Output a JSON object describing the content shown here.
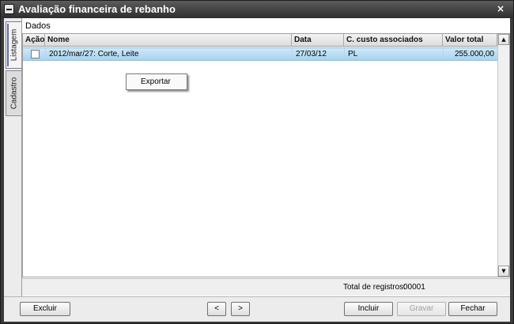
{
  "window": {
    "title": "Avaliação financeira de rebanho",
    "close_label": "×"
  },
  "tabs": [
    {
      "label": "Listagem",
      "active": true
    },
    {
      "label": "Cadastro",
      "active": false
    }
  ],
  "section_label": "Dados",
  "grid": {
    "columns": [
      "Ação",
      "Nome",
      "Data",
      "C. custo associados",
      "Valor total"
    ],
    "rows": [
      {
        "acao_checked": false,
        "nome": "2012/mar/27: Corte, Leite",
        "data": "27/03/12",
        "custo": "PL",
        "valor": "255.000,00"
      }
    ],
    "scroll_up": "▲",
    "scroll_down": "▼"
  },
  "context_menu": {
    "items": [
      "Exportar"
    ]
  },
  "footer": {
    "total_label": "Total de registros:",
    "total_value": "00001"
  },
  "buttons": {
    "excluir": "Excluir",
    "prev": "<",
    "next": ">",
    "incluir": "Incluir",
    "gravar": "Gravar",
    "fechar": "Fechar"
  },
  "colors": {
    "selected_row": "#a9d3ef",
    "titlebar": "#3a3a3a"
  }
}
